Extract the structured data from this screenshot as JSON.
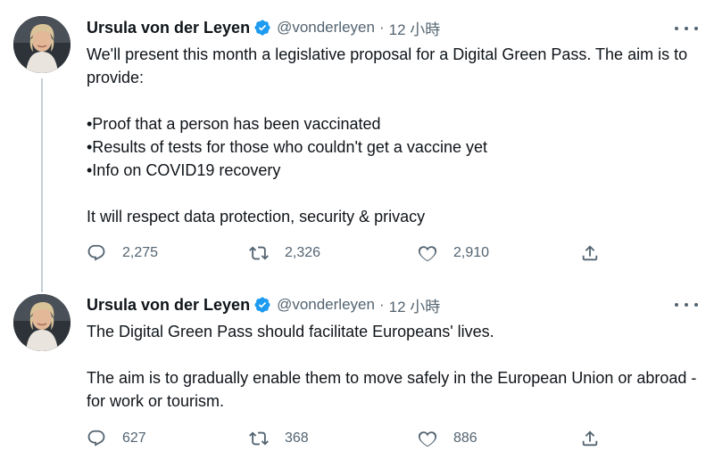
{
  "tweets": [
    {
      "author": {
        "display_name": "Ursula von der Leyen",
        "handle": "@vonderleyen",
        "verified": true
      },
      "separator": "·",
      "time": "12 小時",
      "paragraphs": [
        "We'll present this month a legislative proposal for a Digital Green Pass. The aim is to provide:",
        "•Proof that a person has been vaccinated\n•Results of tests for those who couldn't get a vaccine yet\n•Info on COVID19 recovery",
        "It will respect data protection, security & privacy"
      ],
      "counts": {
        "replies": "2,275",
        "retweets": "2,326",
        "likes": "2,910"
      }
    },
    {
      "author": {
        "display_name": "Ursula von der Leyen",
        "handle": "@vonderleyen",
        "verified": true
      },
      "separator": "·",
      "time": "12 小時",
      "paragraphs": [
        "The Digital Green Pass should facilitate Europeans' lives.",
        "The aim is to gradually enable them to move safely in the European Union or abroad - for work or tourism."
      ],
      "counts": {
        "replies": "627",
        "retweets": "368",
        "likes": "886"
      }
    }
  ],
  "icons": {
    "more": "more-horizontal-icon",
    "reply": "reply-icon",
    "retweet": "retweet-icon",
    "like": "heart-icon",
    "share": "share-icon",
    "verified": "verified-badge-icon"
  },
  "colors": {
    "verified_blue": "#1d9bf0",
    "secondary_text": "#536471",
    "thread_line": "#c4cfd6"
  }
}
